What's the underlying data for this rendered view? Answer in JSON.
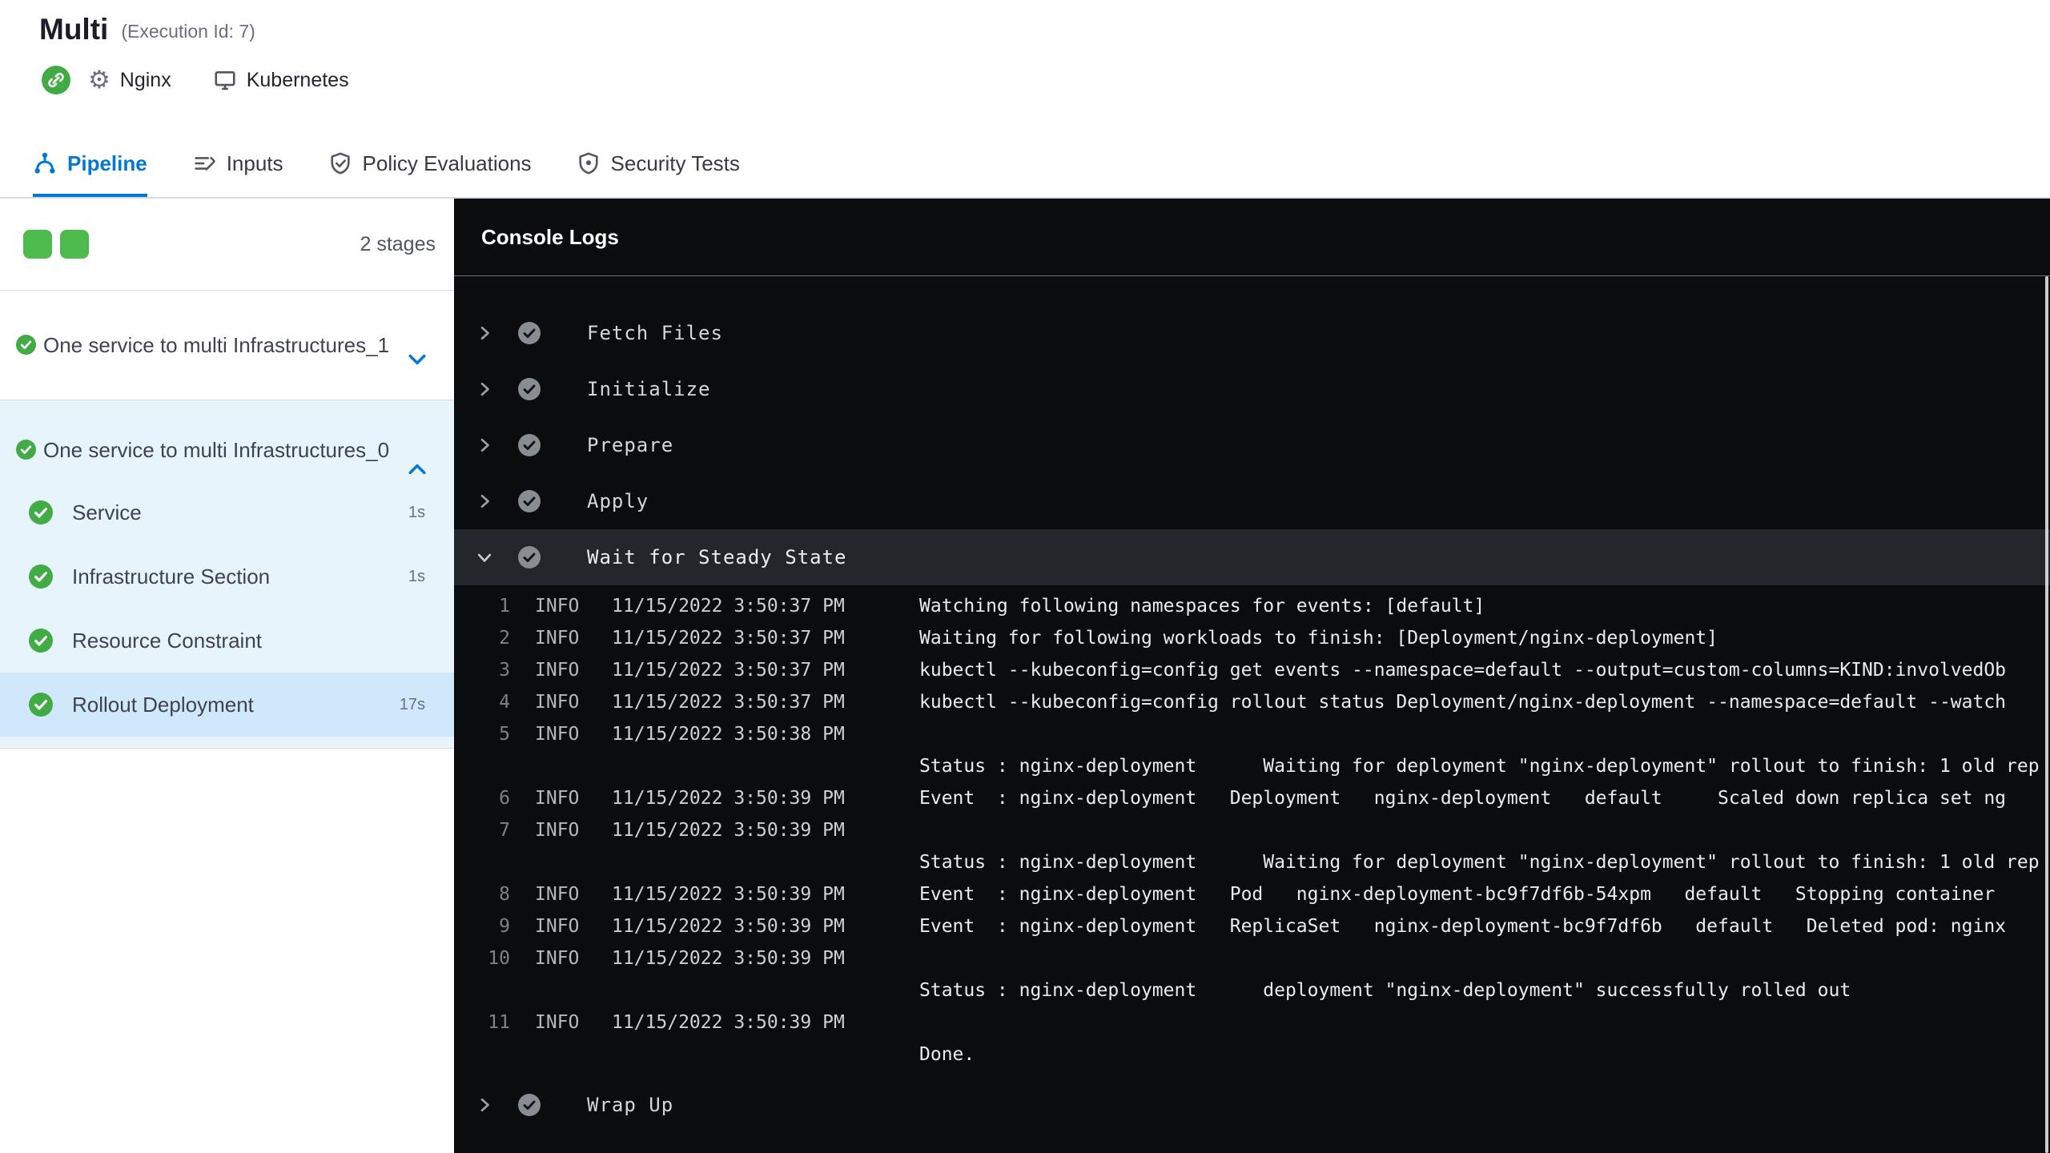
{
  "header": {
    "title": "Multi",
    "execution_id": "(Execution Id: 7)",
    "service_label": "Nginx",
    "infrastructure_label": "Kubernetes"
  },
  "tabs": [
    {
      "label": "Pipeline",
      "active": true
    },
    {
      "label": "Inputs",
      "active": false
    },
    {
      "label": "Policy Evaluations",
      "active": false
    },
    {
      "label": "Security Tests",
      "active": false
    }
  ],
  "sidebar": {
    "stage_count": "2 stages",
    "stages": [
      {
        "label": "One service to multi Infrastructures_1",
        "status": "success",
        "expanded": false
      },
      {
        "label": "One service to multi Infrastructures_0",
        "status": "success",
        "expanded": true,
        "steps": [
          {
            "label": "Service",
            "duration": "1s",
            "selected": false
          },
          {
            "label": "Infrastructure Section",
            "duration": "1s",
            "selected": false
          },
          {
            "label": "Resource Constraint",
            "duration": "",
            "selected": false
          },
          {
            "label": "Rollout Deployment",
            "duration": "17s",
            "selected": true
          }
        ]
      }
    ]
  },
  "console": {
    "title": "Console Logs",
    "steps_before": [
      {
        "label": "Fetch Files"
      },
      {
        "label": "Initialize"
      },
      {
        "label": "Prepare"
      },
      {
        "label": "Apply"
      }
    ],
    "expanded_step": {
      "label": "Wait for Steady State"
    },
    "logs": [
      {
        "num": "1",
        "level": "INFO",
        "time": "11/15/2022 3:50:37 PM",
        "msg": "Watching following namespaces for events: [default]"
      },
      {
        "num": "2",
        "level": "INFO",
        "time": "11/15/2022 3:50:37 PM",
        "msg": "Waiting for following workloads to finish: [Deployment/nginx-deployment]"
      },
      {
        "num": "3",
        "level": "INFO",
        "time": "11/15/2022 3:50:37 PM",
        "msg": "kubectl --kubeconfig=config get events --namespace=default --output=custom-columns=KIND:involvedOb"
      },
      {
        "num": "4",
        "level": "INFO",
        "time": "11/15/2022 3:50:37 PM",
        "msg": "kubectl --kubeconfig=config rollout status Deployment/nginx-deployment --namespace=default --watch"
      },
      {
        "num": "5",
        "level": "INFO",
        "time": "11/15/2022 3:50:38 PM",
        "msg": ""
      },
      {
        "num": "",
        "level": "",
        "time": "",
        "msg": "Status : nginx-deployment      Waiting for deployment \"nginx-deployment\" rollout to finish: 1 old rep"
      },
      {
        "num": "6",
        "level": "INFO",
        "time": "11/15/2022 3:50:39 PM",
        "msg": "Event  : nginx-deployment   Deployment   nginx-deployment   default     Scaled down replica set ng"
      },
      {
        "num": "7",
        "level": "INFO",
        "time": "11/15/2022 3:50:39 PM",
        "msg": ""
      },
      {
        "num": "",
        "level": "",
        "time": "",
        "msg": "Status : nginx-deployment      Waiting for deployment \"nginx-deployment\" rollout to finish: 1 old rep"
      },
      {
        "num": "8",
        "level": "INFO",
        "time": "11/15/2022 3:50:39 PM",
        "msg": "Event  : nginx-deployment   Pod   nginx-deployment-bc9f7df6b-54xpm   default   Stopping container"
      },
      {
        "num": "9",
        "level": "INFO",
        "time": "11/15/2022 3:50:39 PM",
        "msg": "Event  : nginx-deployment   ReplicaSet   nginx-deployment-bc9f7df6b   default   Deleted pod: nginx"
      },
      {
        "num": "10",
        "level": "INFO",
        "time": "11/15/2022 3:50:39 PM",
        "msg": ""
      },
      {
        "num": "",
        "level": "",
        "time": "",
        "msg": "Status : nginx-deployment      deployment \"nginx-deployment\" successfully rolled out"
      },
      {
        "num": "11",
        "level": "INFO",
        "time": "11/15/2022 3:50:39 PM",
        "msg": ""
      },
      {
        "num": "",
        "level": "",
        "time": "",
        "msg": "Done."
      }
    ],
    "steps_after": [
      {
        "label": "Wrap Up"
      }
    ]
  },
  "colors": {
    "accent_blue": "#0278d5",
    "success_green": "#42ab45",
    "stage_square_green": "#4dbb4d",
    "console_bg": "#0b0c0e",
    "expanded_stage_bg": "#e7f4fc",
    "selected_step_bg": "#cfe8fa"
  }
}
